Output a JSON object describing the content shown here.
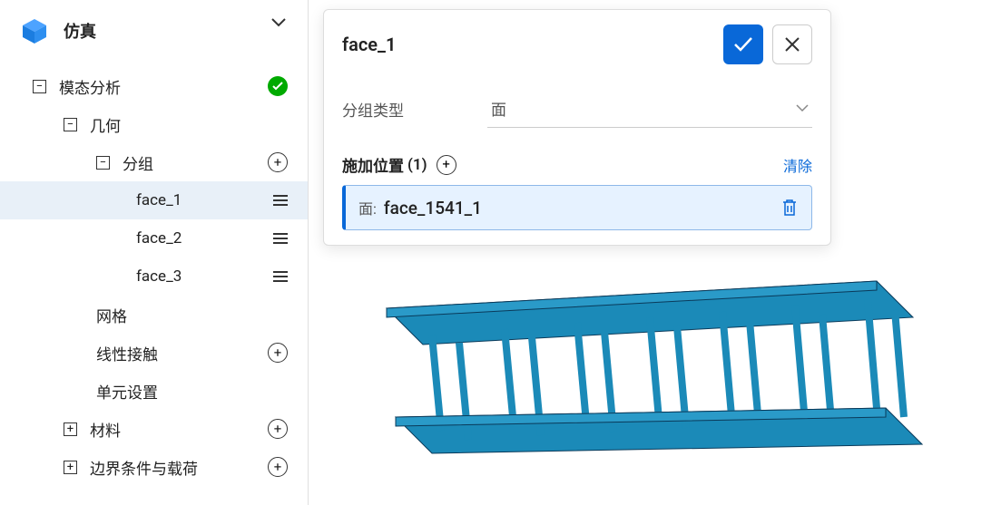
{
  "sidebar": {
    "title": "仿真",
    "root": {
      "label": "模态分析"
    },
    "geometry": {
      "label": "几何"
    },
    "group": {
      "label": "分组"
    },
    "faces": [
      {
        "label": "face_1",
        "selected": true
      },
      {
        "label": "face_2",
        "selected": false
      },
      {
        "label": "face_3",
        "selected": false
      }
    ],
    "mesh": {
      "label": "网格"
    },
    "contact": {
      "label": "线性接触"
    },
    "unitset": {
      "label": "单元设置"
    },
    "material": {
      "label": "材料"
    },
    "bc": {
      "label": "边界条件与载荷"
    }
  },
  "panel": {
    "title": "face_1",
    "group_type_label": "分组类型",
    "group_type_value": "面",
    "location_label": "施加位置",
    "location_count": "(1)",
    "clear_label": "清除",
    "items": [
      {
        "prefix": "面:",
        "name": "face_1541_1"
      }
    ]
  }
}
